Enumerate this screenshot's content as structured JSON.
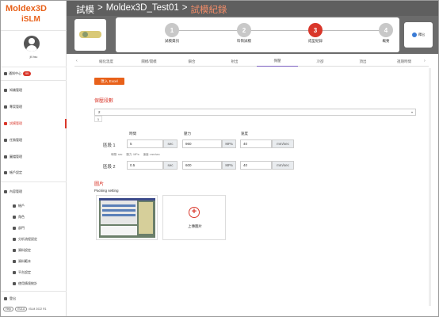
{
  "app": {
    "brand_line1": "Moldex3D",
    "brand_line2": "iSLM"
  },
  "user": {
    "name": "jill.hsu"
  },
  "notifications": {
    "label": "通知中心",
    "count": "99"
  },
  "sidebar": {
    "items": [
      {
        "label": "知識管理"
      },
      {
        "label": "專案管理"
      },
      {
        "label": "試模管理"
      },
      {
        "label": "任務管理"
      },
      {
        "label": "圖檔管理"
      },
      {
        "label": "帳戶設定"
      },
      {
        "label": "內容管理"
      },
      {
        "label": "帳戶"
      },
      {
        "label": "角色"
      },
      {
        "label": "部門"
      },
      {
        "label": "分析流程設定"
      },
      {
        "label": "資料設定"
      },
      {
        "label": "資料範本"
      },
      {
        "label": "平台設定"
      },
      {
        "label": "使用情境統計"
      },
      {
        "label": "登出"
      }
    ],
    "footer": {
      "help": "Help",
      "eula": "EULA",
      "version": "iSLM 2022 R1"
    }
  },
  "header": {
    "crumbs": [
      "試模",
      ">",
      "Moldex3D_Test01",
      ">",
      "試模紀錄"
    ]
  },
  "steps": [
    {
      "num": "1",
      "label": "試模資訊",
      "state": "done"
    },
    {
      "num": "2",
      "label": "料筒試模",
      "state": "done"
    },
    {
      "num": "3",
      "label": "成型紀錄",
      "state": "active"
    },
    {
      "num": "4",
      "label": "概要",
      "state": "todo"
    }
  ],
  "release_label": "釋出",
  "tabs": [
    "縮化溫度",
    "關模/開模",
    "鎖合",
    "射出",
    "保壓",
    "冷卻",
    "頂出",
    "週期時間"
  ],
  "active_tab": 4,
  "import_button": "匯入 Excel",
  "packing": {
    "section_title": "保壓段數",
    "selected": "2",
    "dropdown_option": "1",
    "col_time": "時間",
    "col_pressure": "壓力",
    "col_speed": "速度",
    "rows": [
      {
        "label": "區段 1",
        "time": "5",
        "time_unit": "sec",
        "pressure": "960",
        "pressure_unit": "MPa",
        "speed": "40",
        "speed_unit": "mm/sec"
      },
      {
        "label": "區段 2",
        "time": "0.5",
        "time_unit": "sec",
        "pressure": "600",
        "pressure_unit": "MPa",
        "speed": "40",
        "speed_unit": "mm/sec"
      }
    ],
    "hint": [
      "時間: sec",
      "壓力: MPa",
      "速度: mm/sec"
    ]
  },
  "images": {
    "section_title": "圖片",
    "label": "Packing setting",
    "upload_label": "上傳圖片"
  },
  "colors": {
    "accent": "#d9362a",
    "brand": "#e8611a",
    "header": "#5f5f5f",
    "steps_bg": "#6b6b6b"
  }
}
